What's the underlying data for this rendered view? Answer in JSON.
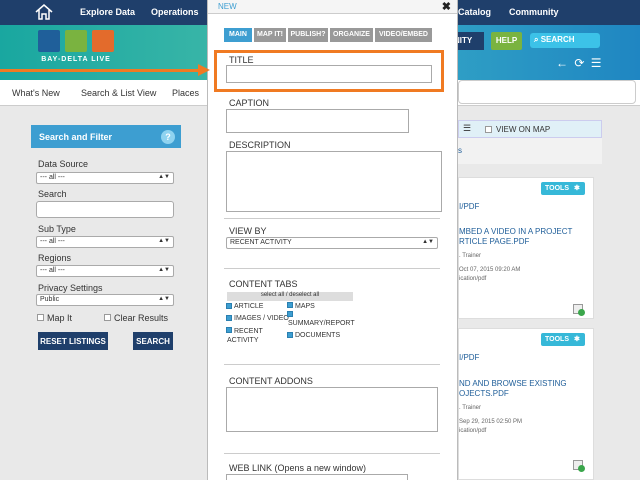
{
  "topnav": {
    "items": [
      "Explore Data",
      "Operations",
      "Catalog",
      "Community"
    ]
  },
  "logo": {
    "caption": "BAY-DELTA LIVE"
  },
  "banner": {
    "community_fragment": "NITY",
    "help_label": "HELP",
    "search_label": "SEARCH"
  },
  "subnav": {
    "items": [
      "What's New",
      "Search & List View",
      "Places"
    ]
  },
  "filter": {
    "title": "Search and Filter",
    "help": "?",
    "data_source_label": "Data Source",
    "data_source_value": "--- all ---",
    "search_label": "Search",
    "subtype_label": "Sub Type",
    "subtype_value": "--- all ---",
    "regions_label": "Regions",
    "regions_value": "--- all ---",
    "privacy_label": "Privacy Settings",
    "privacy_value": "Public",
    "map_it_label": "Map It",
    "clear_results_label": "Clear Results",
    "reset_label": "RESET LISTINGS",
    "search_button": "SEARCH"
  },
  "results": {
    "view_on_map": "VIEW ON MAP",
    "bar_fragment": "s",
    "tools_label": "TOOLS",
    "cards": [
      {
        "type_fragment": "I/PDF",
        "title_line1": "MBED A VIDEO IN A PROJECT",
        "title_line2": "RTICLE PAGE.PDF",
        "author": ". Trainer",
        "date": "Oct 07, 2015 09:20 AM",
        "mime": "ication/pdf"
      },
      {
        "type_fragment": "I/PDF",
        "title_line1": "ND AND BROWSE EXISTING",
        "title_line2": "OJECTS.PDF",
        "author": ". Trainer",
        "date": "Sep 29, 2015 02:50 PM",
        "mime": "ication/pdf"
      }
    ]
  },
  "modal": {
    "title": "NEW",
    "close": "✖",
    "tabs": [
      "MAIN",
      "MAP IT!",
      "PUBLISH?",
      "ORGANIZE",
      "VIDEO/EMBED"
    ],
    "title_label": "TITLE",
    "caption_label": "CAPTION",
    "description_label": "DESCRIPTION",
    "view_by_label": "VIEW BY",
    "view_by_value": "RECENT ACTIVITY",
    "content_tabs_label": "CONTENT TABS",
    "select_all": "select all / deselect all",
    "content_tabs": [
      {
        "label": "ARTICLE",
        "checked": true
      },
      {
        "label": "MAPS",
        "checked": true
      },
      {
        "label": "IMAGES / VIDEO",
        "checked": true
      },
      {
        "label": "SUMMARY/REPORT",
        "checked": true
      },
      {
        "label": "RECENT\nACTIVITY",
        "checked": true
      },
      {
        "label": "DOCUMENTS",
        "checked": true
      }
    ],
    "content_addons_label": "CONTENT ADDONS",
    "web_link_label": "WEB LINK (Opens a new window)"
  },
  "colors": {
    "accent": "#3d9ed1",
    "nav": "#1f3f6b",
    "highlight": "#f07a22",
    "help": "#7ab340"
  }
}
